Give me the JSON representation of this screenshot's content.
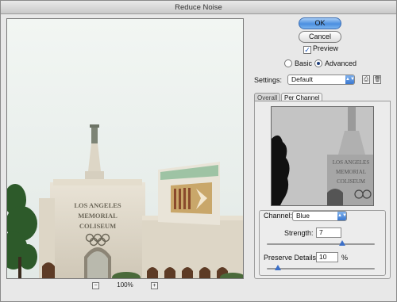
{
  "window": {
    "title": "Reduce Noise"
  },
  "preview": {
    "zoom_out_label": "−",
    "zoom_level": "100%",
    "zoom_in_label": "+",
    "building_sign": [
      "LOS ANGELES",
      "MEMORIAL",
      "COLISEUM"
    ]
  },
  "buttons": {
    "ok": "OK",
    "cancel": "Cancel"
  },
  "options": {
    "preview_label": "Preview",
    "preview_checked": true,
    "mode_basic": "Basic",
    "mode_advanced": "Advanced",
    "mode_selected": "Advanced"
  },
  "settings": {
    "label": "Settings:",
    "value": "Default",
    "save_icon": "save-settings-icon",
    "delete_icon": "trash-icon"
  },
  "tabs": {
    "overall": "Overall",
    "per_channel": "Per Channel",
    "active": "Per Channel"
  },
  "channel": {
    "label": "Channel:",
    "value": "Blue",
    "strength_label": "Strength:",
    "strength_value": "7",
    "strength_fraction": 0.7,
    "preserve_label": "Preserve Details:",
    "preserve_value": "10",
    "preserve_unit": "%",
    "preserve_fraction": 0.1
  },
  "colors": {
    "accent": "#3b78cf",
    "window_bg": "#e8e8e8"
  }
}
